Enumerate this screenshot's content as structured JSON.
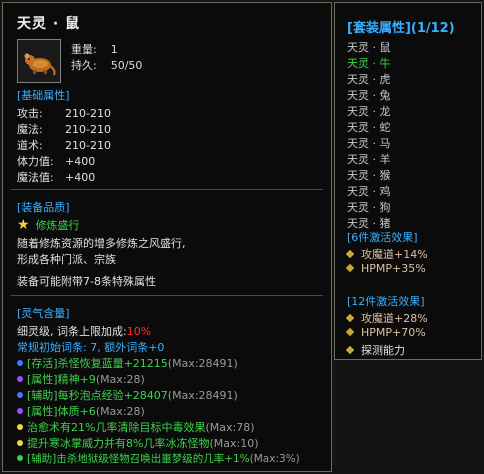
{
  "item": {
    "name": "天灵 · 鼠",
    "weight_label": "重量:",
    "weight_value": "1",
    "durability_label": "持久:",
    "durability_value": "50/50"
  },
  "basic": {
    "header": "[基础属性]",
    "rows": [
      {
        "label": "攻击:",
        "value": "210-210"
      },
      {
        "label": "魔法:",
        "value": "210-210"
      },
      {
        "label": "道术:",
        "value": "210-210"
      },
      {
        "label": "体力值:",
        "value": "+400"
      },
      {
        "label": "魔法值:",
        "value": "+400"
      }
    ]
  },
  "quality": {
    "header": "[装备品质]",
    "star_icon": "star-icon",
    "name": "修炼盛行",
    "desc1": "随着修炼资源的增多修炼之风盛行,",
    "desc2": "形成各种门派、宗族",
    "note": "装备可能附带7-8条特殊属性"
  },
  "spirit": {
    "header": "[灵气含量]",
    "line1_prefix": "细灵级, 词条上限加成:",
    "line1_value": "10%",
    "line2": "常规初始词条: 7, 额外词条+0",
    "bonuses": [
      {
        "text": "[存活]杀怪恢复蓝量+21215",
        "max": "(Max:28491)",
        "dot": "#3a7bff",
        "color": "#3cd44a"
      },
      {
        "text": "[属性]精神+9",
        "max": "(Max:28)",
        "dot": "#a04cff",
        "color": "#3cd44a"
      },
      {
        "text": "[辅助]每秒泡点经验+28407",
        "max": "(Max:28491)",
        "dot": "#3a7bff",
        "color": "#3cd44a"
      },
      {
        "text": "[属性]体质+6",
        "max": "(Max:28)",
        "dot": "#a04cff",
        "color": "#3cd44a"
      },
      {
        "text": "治愈术有21%几率清除目标中毒效果",
        "max": "(Max:78)",
        "dot": "#f5d43b",
        "color": "#f5d43b"
      },
      {
        "text": "提升寒冰掌威力并有8%几率冰冻怪物",
        "max": "(Max:10)",
        "dot": "#f5d43b",
        "color": "#f5d43b"
      },
      {
        "text": "[辅助]击杀地狱级怪物召唤出噩梦级的几率+1%",
        "max": "(Max:3%)",
        "dot": "#3cd44a",
        "color": "#3cd44a"
      }
    ]
  },
  "set": {
    "header": "[套装属性](1/12)",
    "items": [
      {
        "name": "天灵 · 鼠",
        "active": false
      },
      {
        "name": "天灵 · 牛",
        "active": true
      },
      {
        "name": "天灵 · 虎",
        "active": false
      },
      {
        "name": "天灵 · 兔",
        "active": false
      },
      {
        "name": "天灵 · 龙",
        "active": false
      },
      {
        "name": "天灵 · 蛇",
        "active": false
      },
      {
        "name": "天灵 · 马",
        "active": false
      },
      {
        "name": "天灵 · 羊",
        "active": false
      },
      {
        "name": "天灵 · 猴",
        "active": false
      },
      {
        "name": "天灵 · 鸡",
        "active": false
      },
      {
        "name": "天灵 · 狗",
        "active": false
      },
      {
        "name": "天灵 · 猪",
        "active": false
      }
    ],
    "six_header": "[6件激活效果]",
    "six_effects": [
      "攻魔道+14%",
      "HPMP+35%"
    ],
    "twelve_header": "[12件激活效果]",
    "twelve_effects": [
      "攻魔道+28%",
      "HPMP+70%",
      "探测能力"
    ]
  }
}
